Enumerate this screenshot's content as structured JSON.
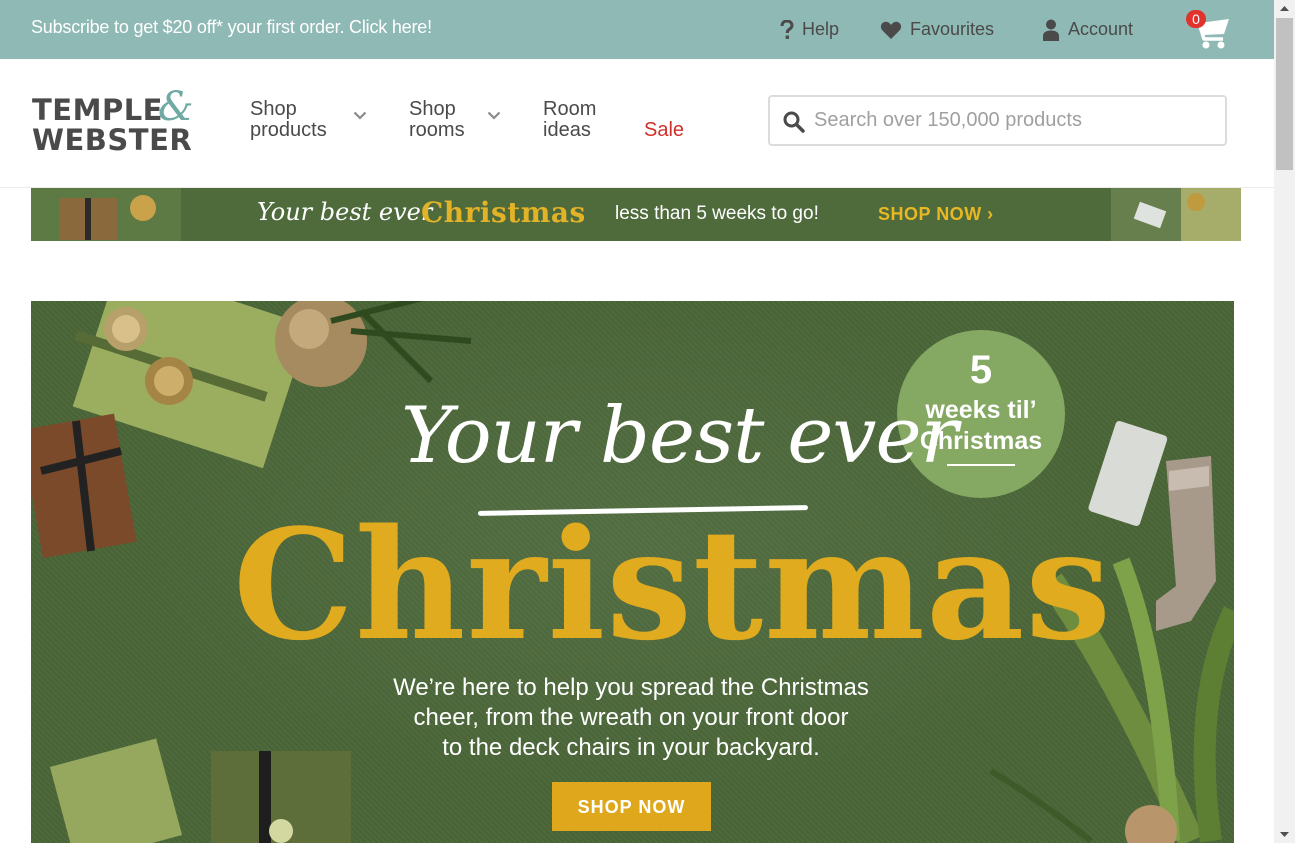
{
  "topbar": {
    "promo": "Subscribe to get $20 off* your first order. Click here!",
    "help": "Help",
    "favourites": "Favourites",
    "account": "Account",
    "cart_count": "0"
  },
  "logo": {
    "line1": "TEMPLE",
    "line2": "WEBSTER",
    "amp": "&"
  },
  "nav": {
    "shop_products": [
      "Shop",
      "products"
    ],
    "shop_rooms": [
      "Shop",
      "rooms"
    ],
    "room_ideas": [
      "Room",
      "ideas"
    ],
    "sale": "Sale"
  },
  "search": {
    "placeholder": "Search over 150,000 products",
    "value": ""
  },
  "strip_banner": {
    "script": "Your best ever",
    "big": "Christmas",
    "text": "less than 5 weeks to go!",
    "cta": "SHOP NOW ›"
  },
  "hero": {
    "script": "Your best ever",
    "big": "Christmas",
    "body": [
      "We’re here to help you spread the Christmas",
      "cheer, from the wreath on your front door",
      "to the deck chairs in your backyard."
    ],
    "button": "SHOP NOW",
    "badge": {
      "number": "5",
      "line1": "weeks til’",
      "line2": "Christmas"
    }
  },
  "colors": {
    "topbar": "#8fb9b5",
    "sale": "#d0302b",
    "hero_green": "#4a6638",
    "gold": "#e0ab1e",
    "badge_green": "#85a862"
  },
  "icons": [
    "question-icon",
    "heart-icon",
    "person-icon",
    "cart-icon",
    "search-icon",
    "chevron-down-icon"
  ]
}
